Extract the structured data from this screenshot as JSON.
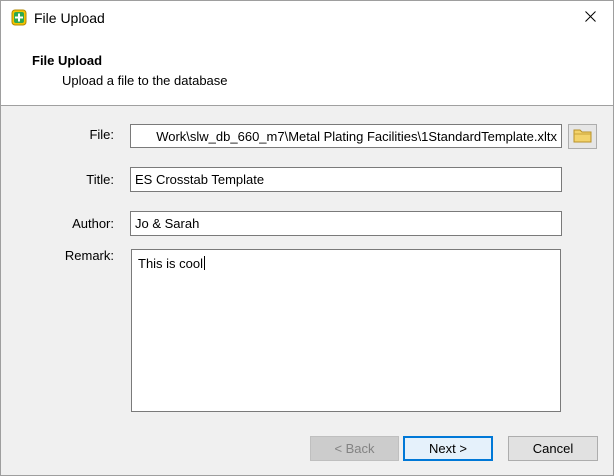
{
  "window": {
    "title": "File Upload"
  },
  "header": {
    "title": "File Upload",
    "subtitle": "Upload a file to the database"
  },
  "form": {
    "file": {
      "label": "File:",
      "value": "Work\\slw_db_660_m7\\Metal Plating Facilities\\1StandardTemplate.xltx"
    },
    "title": {
      "label": "Title:",
      "value": "ES Crosstab Template"
    },
    "author": {
      "label": "Author:",
      "value": "Jo & Sarah"
    },
    "remark": {
      "label": "Remark:",
      "value": "This is cool"
    }
  },
  "buttons": {
    "back": "< Back",
    "next": "Next >",
    "cancel": "Cancel"
  },
  "colors": {
    "accent": "#0078d7",
    "folder": "#e8c45a"
  }
}
